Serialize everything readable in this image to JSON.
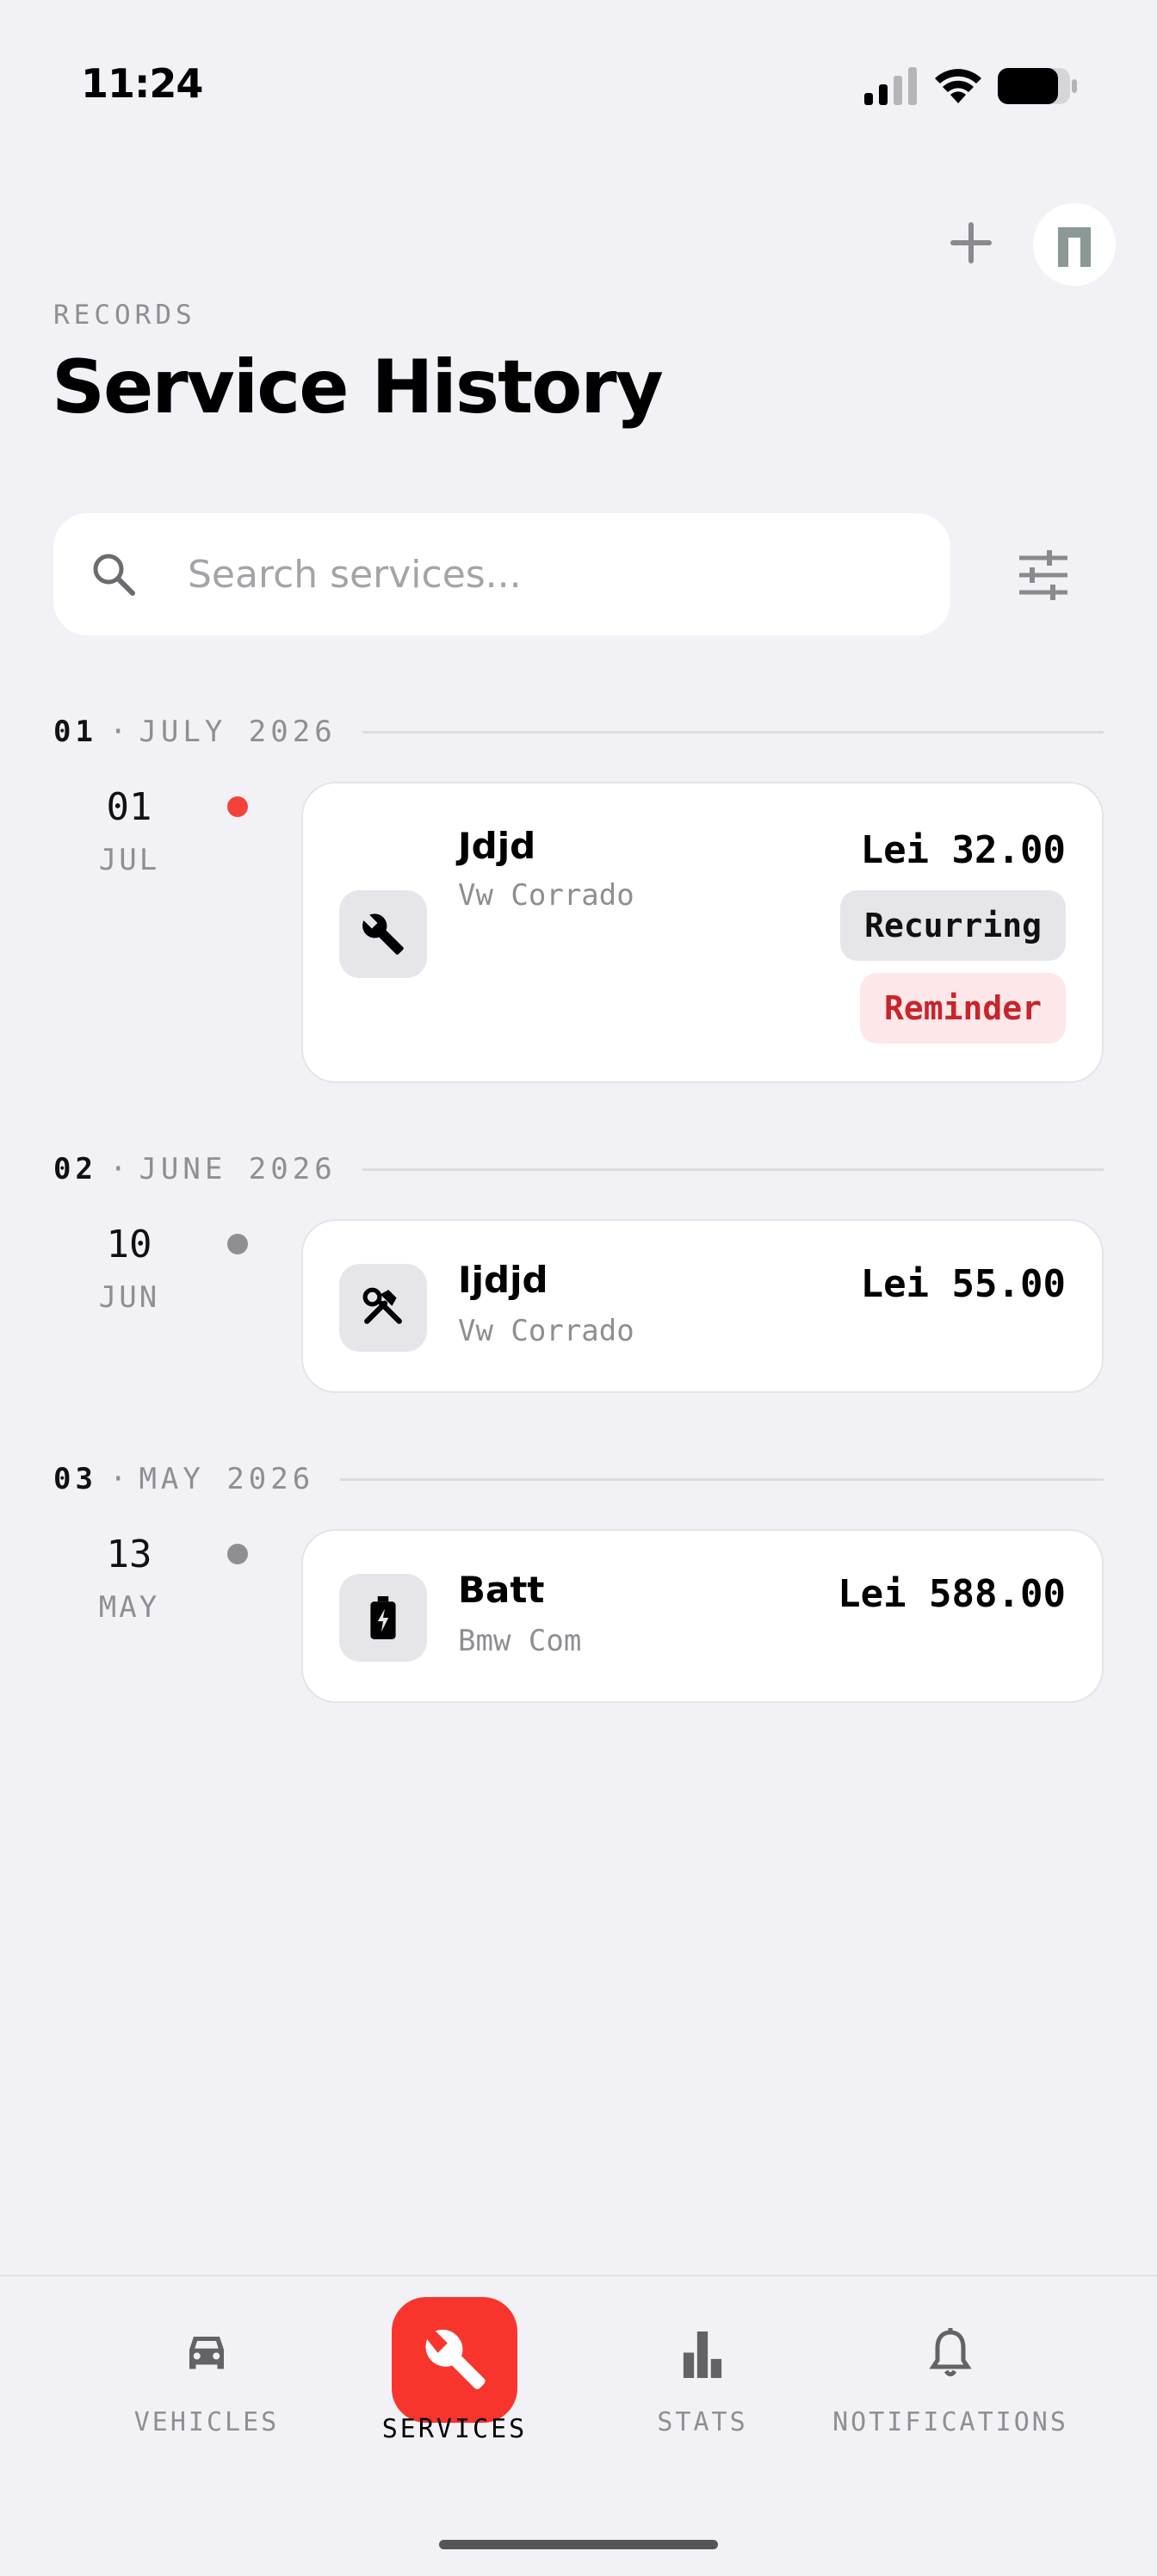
{
  "status_bar": {
    "time": "11:24"
  },
  "header": {
    "eyebrow": "RECORDS",
    "title": "Service History"
  },
  "search": {
    "placeholder": "Search services..."
  },
  "sections": [
    {
      "index": "01",
      "separator": "·",
      "month": "JULY 2026",
      "entries": [
        {
          "day": "01",
          "month_short": "JUL",
          "dot_color": "#f3423a",
          "icon": "wrench-icon",
          "title": "Jdjd",
          "vehicle": "Vw Corrado",
          "price": "Lei 32.00",
          "tags": [
            "Recurring",
            "Reminder"
          ]
        }
      ]
    },
    {
      "index": "02",
      "separator": "·",
      "month": "JUNE 2026",
      "entries": [
        {
          "day": "10",
          "month_short": "JUN",
          "dot_color": "#8e8e93",
          "icon": "hammer-wrench-icon",
          "title": "Ijdjd",
          "vehicle": "Vw Corrado",
          "price": "Lei 55.00"
        }
      ]
    },
    {
      "index": "03",
      "separator": "·",
      "month": "MAY 2026",
      "entries": [
        {
          "day": "13",
          "month_short": "MAY",
          "dot_color": "#8e8e93",
          "icon": "battery-charging-icon",
          "title": "Batt",
          "vehicle": "Bmw Com",
          "price": "Lei 588.00"
        }
      ]
    }
  ],
  "tab_bar": {
    "tabs": [
      {
        "label": "VEHICLES",
        "icon": "car-icon",
        "active": false
      },
      {
        "label": "SERVICES",
        "icon": "wrench-icon",
        "active": true
      },
      {
        "label": "STATS",
        "icon": "bar-chart-icon",
        "active": false
      },
      {
        "label": "NOTIFICATIONS",
        "icon": "bell-icon",
        "active": false
      }
    ]
  },
  "colors": {
    "accent": "#f8352d",
    "background": "#f2f1f6",
    "muted": "#8e8e93",
    "reminder_bg": "#fde7e8",
    "reminder_text": "#c8242c"
  }
}
